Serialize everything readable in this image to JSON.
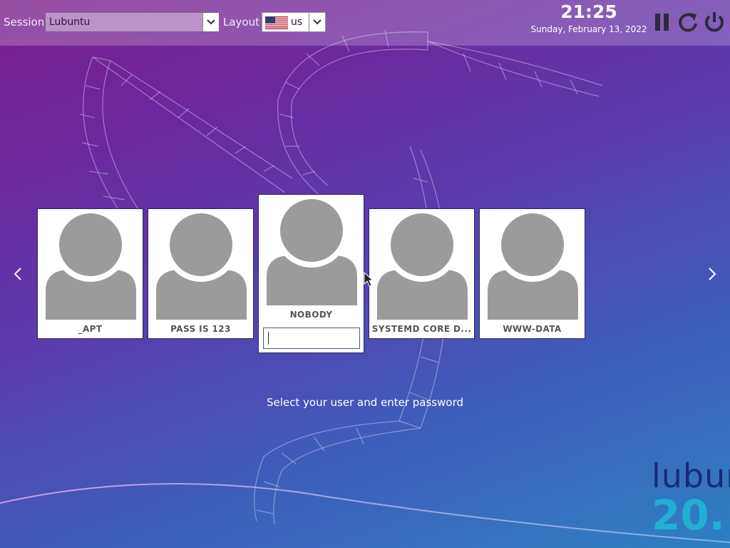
{
  "colors": {
    "accent": "#1fb0d4",
    "brand_dark": "#1a2a78",
    "avatar_gray": "#9b9b9b"
  },
  "topbar": {
    "session_label": "Session",
    "session_value": "Lubuntu",
    "layout_label": "Layout",
    "layout_value": "us",
    "layout_flag_icon": "us-flag-icon",
    "time": "21:25",
    "date": "Sunday, February 13, 2022",
    "controls": [
      {
        "name": "suspend",
        "icon": "pause-icon"
      },
      {
        "name": "restart",
        "icon": "restart-icon"
      },
      {
        "name": "shutdown",
        "icon": "power-icon"
      }
    ]
  },
  "users": {
    "cards": [
      {
        "name": "_APT",
        "avatar_icon": "user-silhouette-icon"
      },
      {
        "name": "PASS IS 123",
        "avatar_icon": "user-silhouette-icon"
      },
      {
        "name": "NOBODY",
        "avatar_icon": "user-silhouette-icon",
        "selected": true,
        "password_value": ""
      },
      {
        "name": "SYSTEMD CORE D...",
        "avatar_icon": "user-silhouette-icon"
      },
      {
        "name": "WWW-DATA",
        "avatar_icon": "user-silhouette-icon"
      }
    ],
    "prev_icon": "chevron-left-icon",
    "next_icon": "chevron-right-icon"
  },
  "hint": "Select your user and enter password",
  "brand": {
    "name": "lubun",
    "version": "20."
  }
}
